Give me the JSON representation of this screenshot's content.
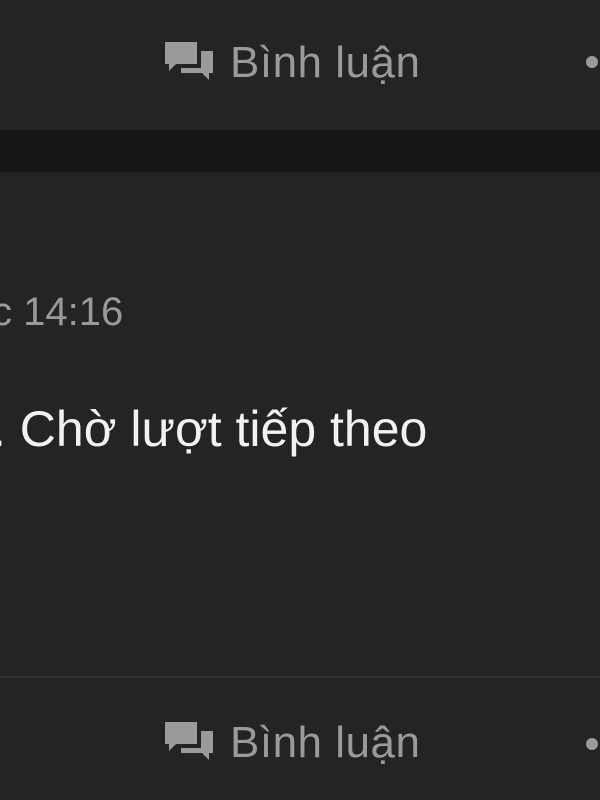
{
  "top_bar": {
    "comment_label": "Bình luận",
    "comment_icon": "speech-bubbles-icon",
    "more_icon": "more-dot-icon"
  },
  "post": {
    "timestamp": "c 14:16",
    "text": ". Chờ lượt tiếp theo"
  },
  "bottom_bar": {
    "comment_label": "Bình luận",
    "comment_icon": "speech-bubbles-icon",
    "more_icon": "more-dot-icon"
  },
  "colors": {
    "background": "#242424",
    "divider": "#161616",
    "muted_text": "#9a9a9a",
    "primary_text": "#f2f2f2"
  }
}
